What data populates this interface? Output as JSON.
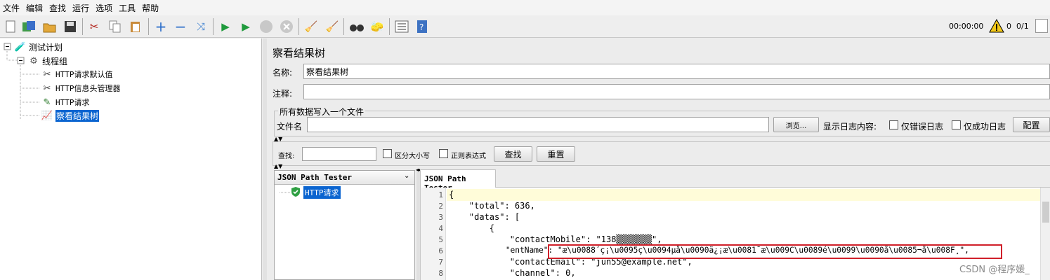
{
  "menu": [
    "文件",
    "编辑",
    "查找",
    "运行",
    "选项",
    "工具",
    "帮助"
  ],
  "toolbar": {
    "icons": [
      "new-icon",
      "templates-icon",
      "open-icon",
      "save-icon",
      "cut-icon",
      "copy-icon",
      "paste-icon",
      "expand-icon",
      "collapse-icon",
      "toggle-icon",
      "start-icon",
      "start-no-pause-icon",
      "stop-icon",
      "shutdown-icon",
      "clear-icon",
      "clear-all-icon",
      "search-icon",
      "reset-search-icon",
      "function-helper-icon",
      "help-icon"
    ],
    "timer": "00:00:00",
    "warnings": "0",
    "threads": "0/1"
  },
  "tree": {
    "items": [
      {
        "label": "测试计划",
        "icon": "test-plan-icon"
      },
      {
        "label": "线程组",
        "icon": "thread-group-icon"
      },
      {
        "label": "HTTP请求默认值",
        "icon": "config-element-icon"
      },
      {
        "label": "HTTP信息头管理器",
        "icon": "header-manager-icon"
      },
      {
        "label": "HTTP请求",
        "icon": "http-sampler-icon"
      },
      {
        "label": "察看结果树",
        "icon": "listener-icon"
      }
    ]
  },
  "panel": {
    "title": "察看结果树",
    "name_label": "名称:",
    "name_value": "察看结果树",
    "comment_label": "注释:",
    "comment_value": "",
    "file_section": "所有数据写入一个文件",
    "file_label": "文件名",
    "file_value": "",
    "browse": "浏览...",
    "log_label": "显示日志内容:",
    "errors_only": "仅错误日志",
    "success_only": "仅成功日志",
    "configure": "配置"
  },
  "search": {
    "label": "查找:",
    "value": "",
    "case_sensitive": "区分大小写",
    "regex": "正则表达式",
    "find": "查找",
    "reset": "重置"
  },
  "results": {
    "renderer": "JSON Path Tester",
    "tab": "JSON Path Tester",
    "sample": "HTTP请求"
  },
  "code": {
    "lines": [
      {
        "n": "1",
        "text": "{"
      },
      {
        "n": "2",
        "text": "    \"total\": 636,"
      },
      {
        "n": "3",
        "text": "    \"datas\": ["
      },
      {
        "n": "4",
        "text": "        {"
      },
      {
        "n": "5",
        "text": "            \"contactMobile\": \"138▒▒▒▒▒▒▒\","
      },
      {
        "n": "6",
        "text": "            \"entName\": \"æ\\u0088´ç¡\\u0095ç\\u0094µå­\\u0090ä¿¡æ\\u0081¯æ\\u009C\\u0089é\\u0099\\u0090å\\u0085¬å\\u008F¸\","
      },
      {
        "n": "7",
        "text": "            \"contactEmail\": \"jun55@example.net\","
      },
      {
        "n": "8",
        "text": "            \"channel\": 0,"
      }
    ]
  },
  "watermark": "CSDN @程序媛_",
  "colors": {
    "selection": "#0a64d0",
    "highlight_box": "#d0202a",
    "active_line": "#fffcd9"
  }
}
